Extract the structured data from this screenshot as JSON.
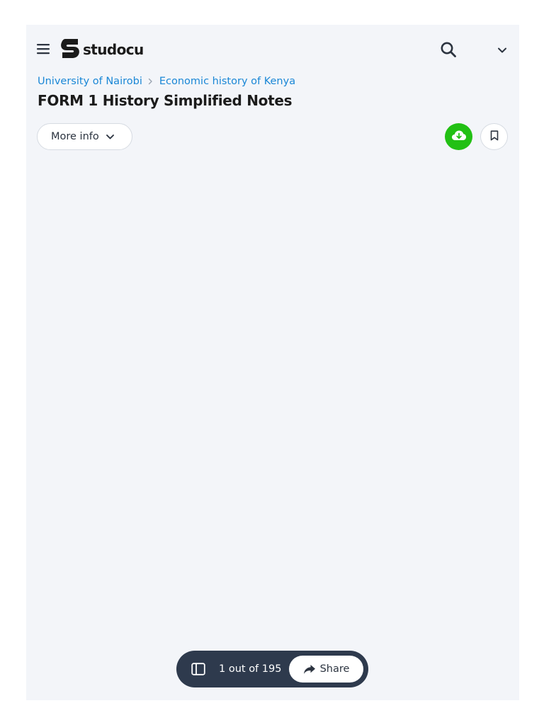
{
  "header": {
    "logo_text": "studocu",
    "icons": {
      "menu": "hamburger-menu-icon",
      "logo": "studocu-logo-icon",
      "search": "search-icon",
      "dropdown": "chevron-down-icon"
    }
  },
  "breadcrumb": {
    "items": [
      {
        "label": "University of Nairobi"
      },
      {
        "label": "Economic history of Kenya"
      }
    ]
  },
  "document": {
    "title": "FORM 1 History Simplified Notes"
  },
  "actions": {
    "more_info_label": "More info",
    "download_icon": "cloud-download-icon",
    "bookmark_icon": "bookmark-icon"
  },
  "pager": {
    "page_text": "1 out of 195",
    "share_label": "Share",
    "sidebar_icon": "sidebar-panel-icon",
    "share_icon": "share-arrow-icon"
  },
  "colors": {
    "background": "#f3f5f9",
    "link": "#1a87d6",
    "download_green": "#22c014",
    "pager_dark": "#2e3a4d",
    "title_text": "#1b1b1b"
  }
}
